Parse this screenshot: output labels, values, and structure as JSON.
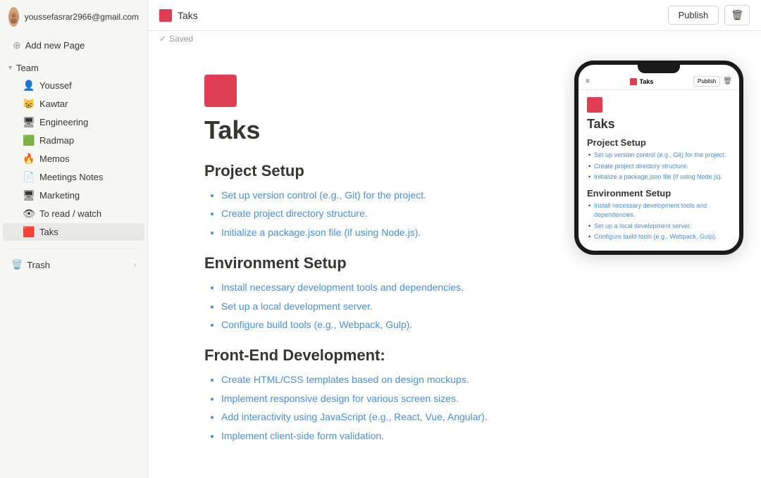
{
  "user": {
    "email": "youssefasrar2966@gmail.com"
  },
  "sidebar": {
    "add_new_page_label": "Add new Page",
    "team_label": "Team",
    "items": [
      {
        "id": "youssef",
        "label": "Youssef",
        "icon": "👤",
        "emoji": true
      },
      {
        "id": "kawtar",
        "label": "Kawtar",
        "icon": "😸",
        "emoji": true
      },
      {
        "id": "engineering",
        "label": "Engineering",
        "icon": "🖥️",
        "emoji": true
      },
      {
        "id": "radmap",
        "label": "Radmap",
        "icon": "🟩",
        "emoji": true
      },
      {
        "id": "memos",
        "label": "Memos",
        "icon": "🔥",
        "emoji": true
      },
      {
        "id": "meetings-notes",
        "label": "Meetings Notes",
        "icon": "📄",
        "emoji": true
      },
      {
        "id": "marketing",
        "label": "Marketing",
        "icon": "🖥",
        "emoji": true
      },
      {
        "id": "to-read-watch",
        "label": "To read / watch",
        "icon": "👁️",
        "emoji": true
      },
      {
        "id": "taks",
        "label": "Taks",
        "icon": "🟥",
        "emoji": false,
        "active": true
      }
    ],
    "trash_label": "Trash"
  },
  "topbar": {
    "title": "Taks",
    "publish_label": "Publish",
    "saved_label": "Saved"
  },
  "editor": {
    "title": "Taks",
    "sections": [
      {
        "heading": "Project Setup",
        "bullets": [
          "Set up version control (e.g., Git) for the project.",
          "Create project directory structure.",
          "Initialize a package.json file (if using Node.js)."
        ]
      },
      {
        "heading": "Environment Setup",
        "bullets": [
          "Install necessary development tools and dependencies.",
          "Set up a local development server.",
          "Configure build tools (e.g., Webpack, Gulp)."
        ]
      },
      {
        "heading": "Front-End Development:",
        "bullets": [
          "Create HTML/CSS templates based on design mockups.",
          "Implement responsive design for various screen sizes.",
          "Add interactivity using JavaScript (e.g., React, Vue, Angular).",
          "Implement client-side form validation."
        ]
      }
    ]
  },
  "phone": {
    "title": "Taks",
    "publish_label": "Publish",
    "sections": [
      {
        "heading": "Project Setup",
        "bullets": [
          "Set up version control (e.g., Git) for the project.",
          "Create project directory structure.",
          "Initialize a package.json file (if using Node.js)."
        ]
      },
      {
        "heading": "Environment Setup",
        "bullets": [
          "Install necessary development tools and dependencies.",
          "Set up a local development server.",
          "Configure build tools (e.g., Webpack, Gulp)."
        ]
      }
    ]
  }
}
